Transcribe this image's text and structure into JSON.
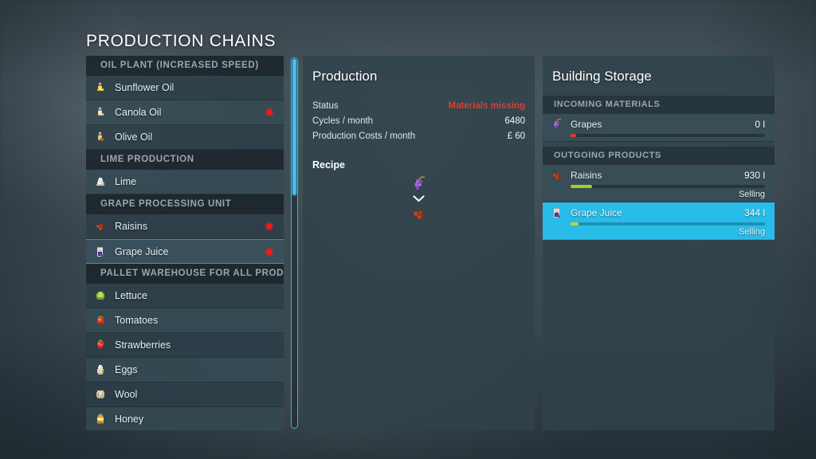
{
  "page": {
    "title": "PRODUCTION CHAINS",
    "accent_color": "#29bce8",
    "alert_color": "#e23b2e"
  },
  "chain_list": {
    "groups": [
      {
        "header": "OIL PLANT (INCREASED SPEED)",
        "items": [
          {
            "label": "Sunflower Oil",
            "icon": "sunflower-oil-icon",
            "warning": false,
            "selected": false
          },
          {
            "label": "Canola Oil",
            "icon": "canola-oil-icon",
            "warning": true,
            "selected": false
          },
          {
            "label": "Olive Oil",
            "icon": "olive-oil-icon",
            "warning": false,
            "selected": false
          }
        ]
      },
      {
        "header": "LIME PRODUCTION",
        "items": [
          {
            "label": "Lime",
            "icon": "lime-icon",
            "warning": false,
            "selected": false
          }
        ]
      },
      {
        "header": "GRAPE PROCESSING UNIT",
        "items": [
          {
            "label": "Raisins",
            "icon": "raisins-icon",
            "warning": true,
            "selected": false
          },
          {
            "label": "Grape Juice",
            "icon": "grape-juice-icon",
            "warning": true,
            "selected": true
          }
        ]
      },
      {
        "header": "PALLET WAREHOUSE FOR ALL PRODUC...",
        "items": [
          {
            "label": "Lettuce",
            "icon": "lettuce-icon",
            "warning": false,
            "selected": false
          },
          {
            "label": "Tomatoes",
            "icon": "tomato-icon",
            "warning": false,
            "selected": false
          },
          {
            "label": "Strawberries",
            "icon": "strawberry-icon",
            "warning": false,
            "selected": false
          },
          {
            "label": "Eggs",
            "icon": "egg-icon",
            "warning": false,
            "selected": false
          },
          {
            "label": "Wool",
            "icon": "wool-icon",
            "warning": false,
            "selected": false
          },
          {
            "label": "Honey",
            "icon": "honey-icon",
            "warning": false,
            "selected": false
          }
        ]
      }
    ]
  },
  "production": {
    "title": "Production",
    "stats": [
      {
        "key": "Status",
        "value": "Materials missing",
        "alert": true
      },
      {
        "key": "Cycles / month",
        "value": "6480",
        "alert": false
      },
      {
        "key": "Production Costs / month",
        "value": "£ 60",
        "alert": false
      }
    ],
    "recipe_title": "Recipe",
    "recipe": {
      "input": {
        "label": "Grapes",
        "icon": "grapes-icon"
      },
      "arrow": "chevron-down-icon",
      "output": {
        "label": "Raisins",
        "icon": "raisins-icon"
      }
    }
  },
  "storage": {
    "title": "Building Storage",
    "incoming_header": "INCOMING MATERIALS",
    "incoming": [
      {
        "name": "Grapes",
        "icon": "grapes-icon",
        "amount": "0 l",
        "fill_percent": 3,
        "fill_color": "#e23b2e",
        "status": "",
        "highlight": false
      }
    ],
    "outgoing_header": "OUTGOING PRODUCTS",
    "outgoing": [
      {
        "name": "Raisins",
        "icon": "raisins-icon",
        "amount": "930 l",
        "fill_percent": 11,
        "fill_color": "#9ed122",
        "status": "Selling",
        "highlight": false
      },
      {
        "name": "Grape Juice",
        "icon": "grape-juice-icon",
        "amount": "344 l",
        "fill_percent": 4,
        "fill_color": "#b5d936",
        "status": "Selling",
        "highlight": true
      }
    ]
  },
  "scrollbar": {
    "thumb_percent": 37
  }
}
